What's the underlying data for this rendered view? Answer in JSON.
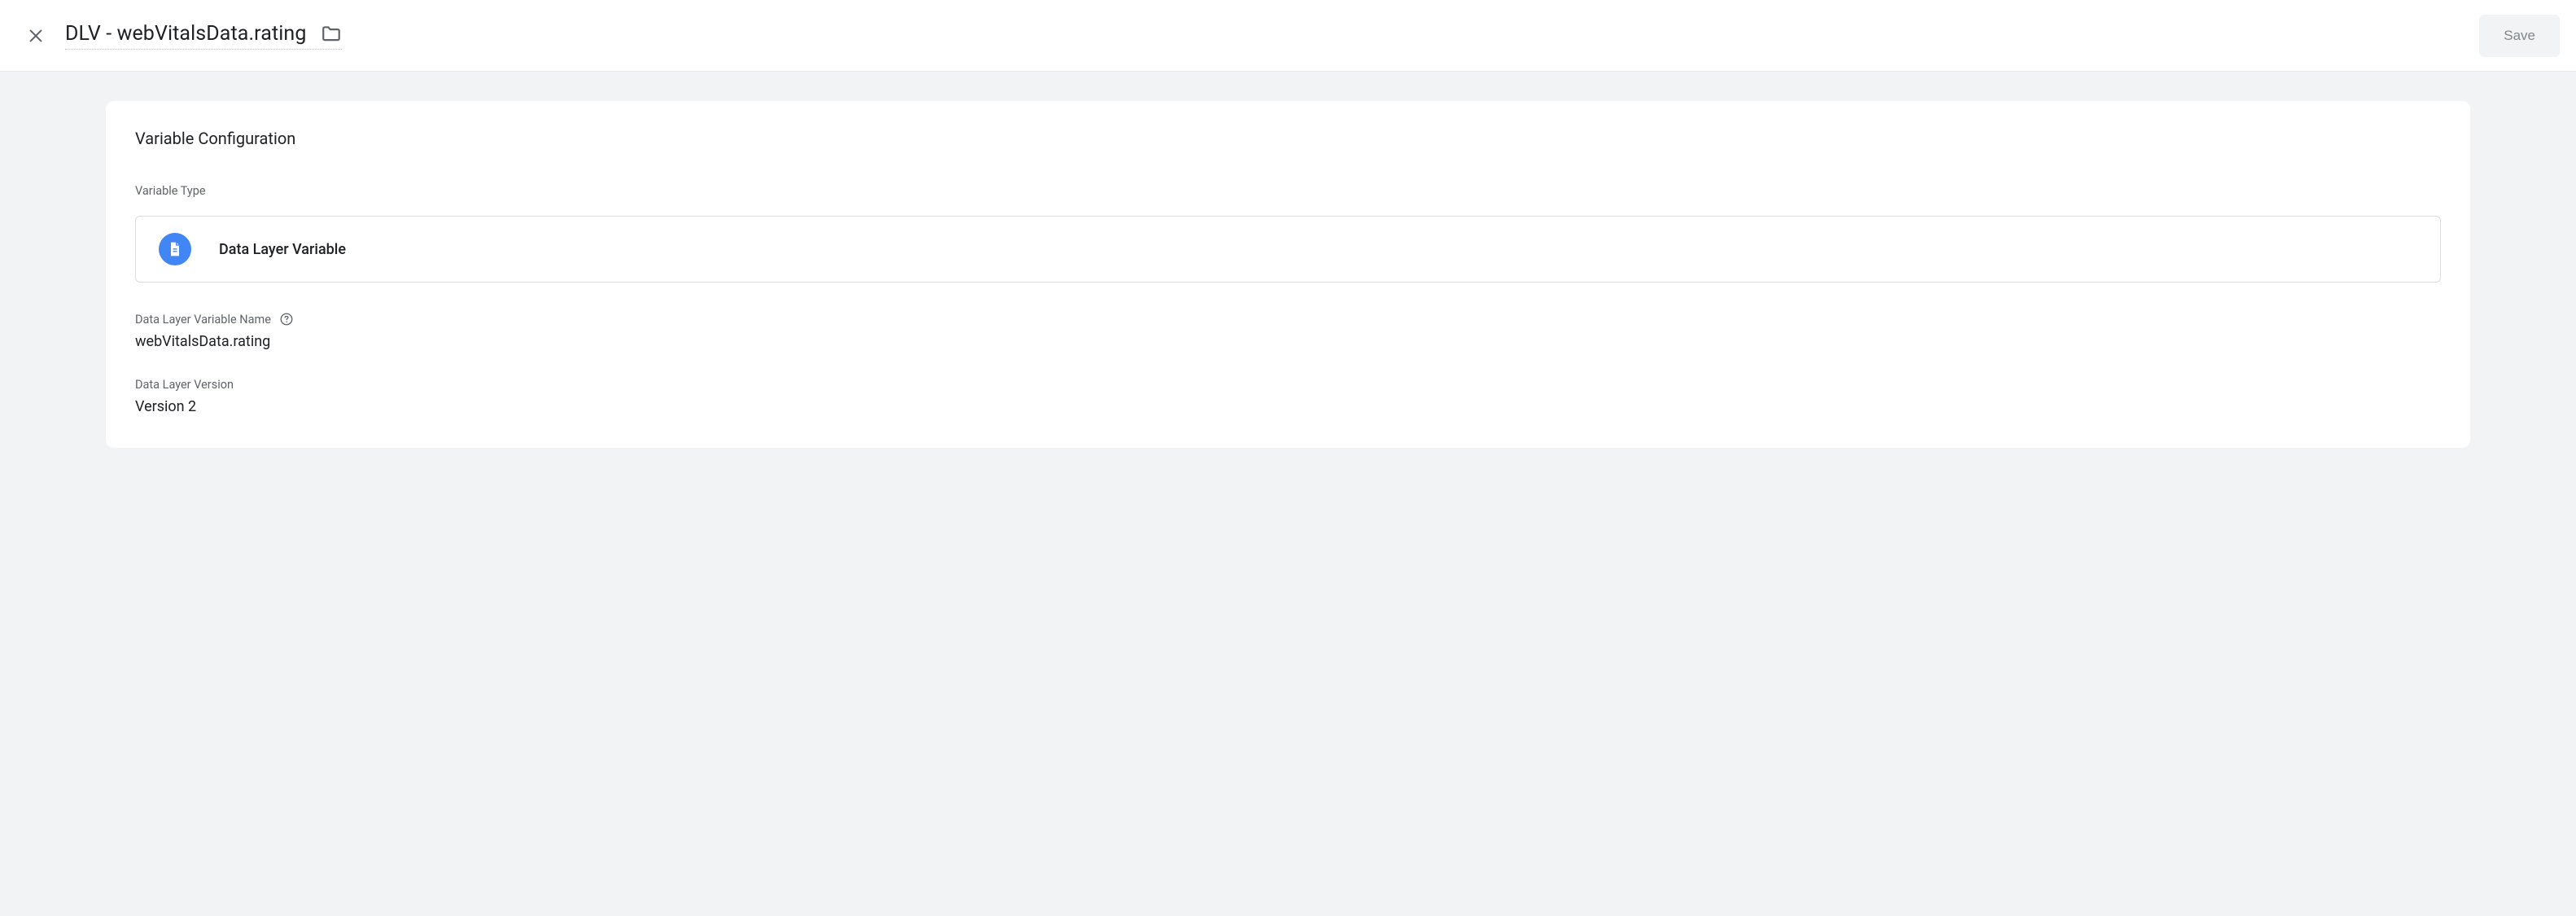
{
  "header": {
    "title": "DLV - webVitalsData.rating",
    "save_label": "Save"
  },
  "card": {
    "title": "Variable Configuration",
    "variable_type_label": "Variable Type",
    "variable_type_value": "Data Layer Variable",
    "dlv_name_label": "Data Layer Variable Name",
    "dlv_name_value": "webVitalsData.rating",
    "dlv_version_label": "Data Layer Version",
    "dlv_version_value": "Version 2"
  }
}
